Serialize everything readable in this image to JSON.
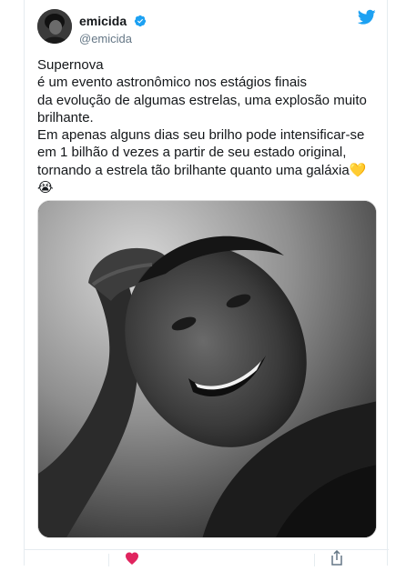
{
  "author": {
    "display_name": "emicida",
    "handle": "@emicida"
  },
  "tweet": {
    "lines": [
      "Supernova",
      "é um evento astronômico nos estágios finais",
      "da evolução de algumas estrelas, uma explosão muito",
      "brilhante.",
      "Em apenas alguns dias seu brilho pode intensificar-se",
      "em 1 bilhão d vezes a partir de seu estado original,",
      "tornando a estrela tão brilhante quanto uma galáxia"
    ],
    "emoji_heart": "💛",
    "emoji_crying": "😭"
  },
  "media": {
    "alt": "Black and white photo of a smiling man resting his head on his hand"
  },
  "icons": {
    "verified": "verified-badge-icon",
    "bird": "twitter-bird-icon",
    "like": "heart-icon",
    "share": "share-icon"
  },
  "colors": {
    "twitter_blue": "#1da1f2",
    "text": "#14171a",
    "muted": "#657786",
    "like_red": "#e0245e"
  }
}
